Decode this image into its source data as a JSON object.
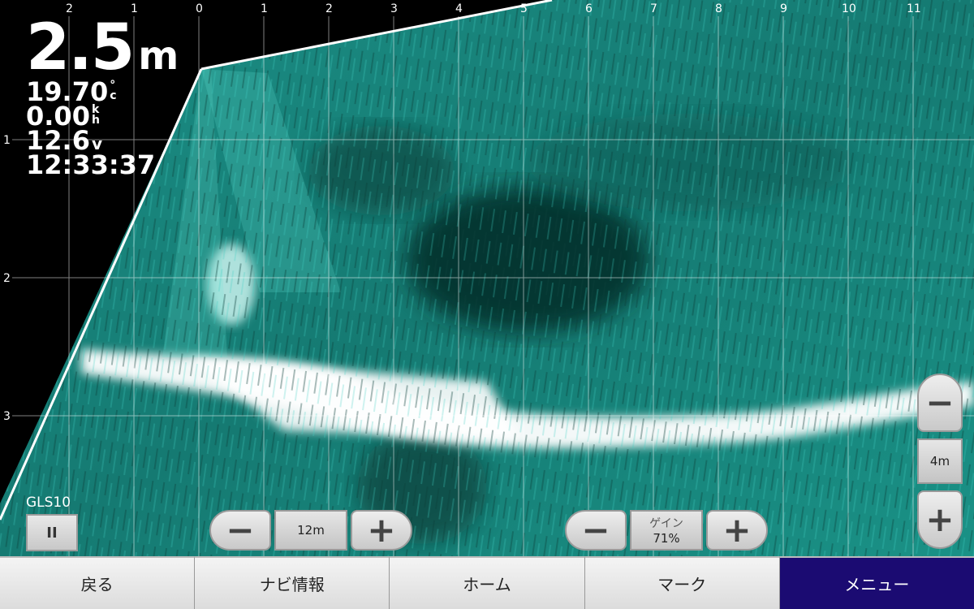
{
  "readouts": {
    "depth_value": "2.5",
    "depth_unit": "m",
    "water_temp": "19.70",
    "temp_unit_top": "°",
    "temp_unit_bottom": "c",
    "speed": "0.00",
    "speed_unit_top": "k",
    "speed_unit_bottom": "h",
    "voltage": "12.6",
    "voltage_unit": "v",
    "time": "12:33:37"
  },
  "top_scale": [
    "2",
    "1",
    "0",
    "1",
    "2",
    "3",
    "4",
    "5",
    "6",
    "7",
    "8",
    "9",
    "10",
    "11"
  ],
  "left_scale": [
    "1",
    "2",
    "3"
  ],
  "range_control": {
    "minus": "−",
    "value": "12m",
    "plus": "+"
  },
  "gain_control": {
    "minus": "−",
    "label": "ゲイン",
    "value": "71%",
    "plus": "+"
  },
  "side_zoom": {
    "minus": "−",
    "value": "4m",
    "plus": "+"
  },
  "transducer": {
    "label": "GLS10",
    "pause_symbol": "II"
  },
  "bottom_nav": [
    {
      "label": "戻る",
      "active": false
    },
    {
      "label": "ナビ情報",
      "active": false
    },
    {
      "label": "ホーム",
      "active": false
    },
    {
      "label": "マーク",
      "active": false
    },
    {
      "label": "メニュー",
      "active": true
    }
  ],
  "colors": {
    "sonar": "#1aa89a",
    "sonar_bright": "#ffffff",
    "menu_active": "#1b0b72"
  }
}
